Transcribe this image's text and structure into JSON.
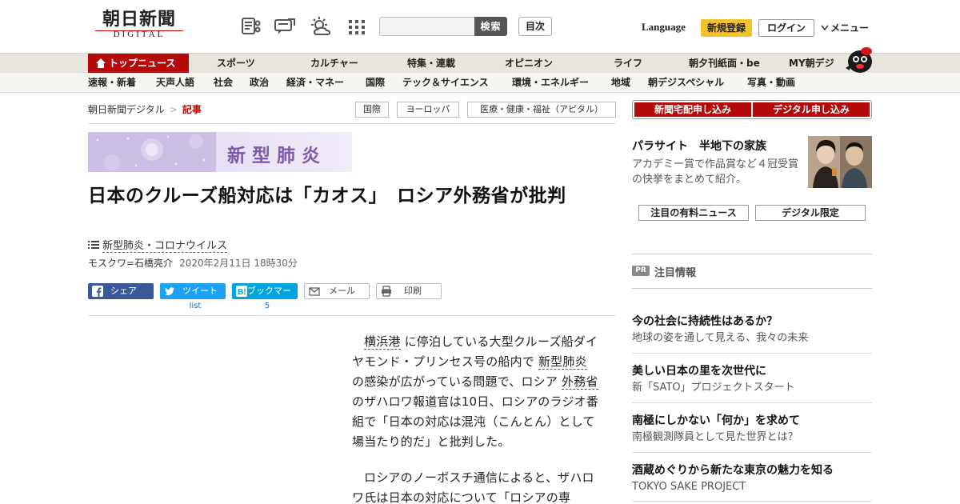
{
  "header": {
    "logo_jp": "朝日新聞",
    "logo_en": "DIGITAL",
    "search_button": "検索",
    "toc_button": "目次",
    "language": "Language",
    "register": "新規登録",
    "login": "ログイン",
    "menu": "メニュー",
    "icons": [
      "newspaper-icon",
      "speech-bubble-icon",
      "weather-icon",
      "grid-icon"
    ]
  },
  "categories": [
    "トップニュース",
    "スポーツ",
    "カルチャー",
    "特集・連載",
    "オピニオン",
    "ライフ",
    "朝夕刊紙面・be",
    "MY朝デジ"
  ],
  "subnav": [
    "速報・新着",
    "天声人語",
    "社会",
    "政治",
    "経済・マネー",
    "国際",
    "テック＆サイエンス",
    "環境・エネルギー",
    "地域",
    "朝デジスペシャル",
    "写真・動画"
  ],
  "breadcrumb": {
    "site": "朝日新聞デジタル",
    "sep": ">",
    "current": "記事"
  },
  "tags": [
    "国際",
    "ヨーロッパ",
    "医療・健康・福祉（アピタル）"
  ],
  "banner": {
    "text": "新型肺炎"
  },
  "article": {
    "headline": "日本のクルーズ船対応は「カオス」　ロシア外務省が批判",
    "topic": "新型肺炎・コロナウイルス",
    "author": "モスクワ=石橋亮介",
    "date": "2020年2月11日 18時30分",
    "para1": {
      "link1": "横浜港",
      "text1": "に停泊している大型クルーズ船ダイヤモンド・プリンセス号の船内で",
      "link2": "新型肺炎",
      "text2": "の感染が広がっている問題で、ロシア",
      "link3": "外務省",
      "text3": "のザハロワ報道官は10日、ロシアのラジオ番組で「日本の対応は混沌（こんとん）として場当たり的だ」と批判した。"
    },
    "para2": "ロシアのノーボスチ通信によると、ザハロワ氏は日本の対応について「ロシアの専"
  },
  "share": {
    "facebook": "シェア",
    "twitter": "ツイート",
    "twitter_count": "list",
    "hatena": "ブックマーク",
    "hatena_count": "5",
    "mail": "メール",
    "print": "印刷"
  },
  "sidebar": {
    "subscribe_home": "新聞宅配申し込み",
    "subscribe_digital": "デジタル申し込み",
    "promo_title": "パラサイト　半地下の家族",
    "promo_desc": "アカデミー賞で作品賞など４冠受賞の快挙をまとめて紹介。",
    "btn_paid": "注目の有料ニュース",
    "btn_digital": "デジタル限定",
    "pr_badge": "PR",
    "pr_title": "注目情報",
    "pr_items": [
      {
        "title": "今の社会に持続性はあるか？",
        "desc": "地球の姿を通して見える、我々の未来"
      },
      {
        "title": "美しい日本の里を次世代に",
        "desc": "新「SATO」プロジェクトスタート"
      },
      {
        "title": "南極にしかない「何か」を求めて",
        "desc": "南極観測隊員として見た世界とは？"
      },
      {
        "title": "酒蔵めぐりから新たな東京の魅力を知る",
        "desc": "TOKYO SAKE PROJECT"
      }
    ]
  },
  "colors": {
    "brand_red": "#b40a0a",
    "accent_yellow": "#f4c22d",
    "banner_purple": "#7e5aa8"
  }
}
